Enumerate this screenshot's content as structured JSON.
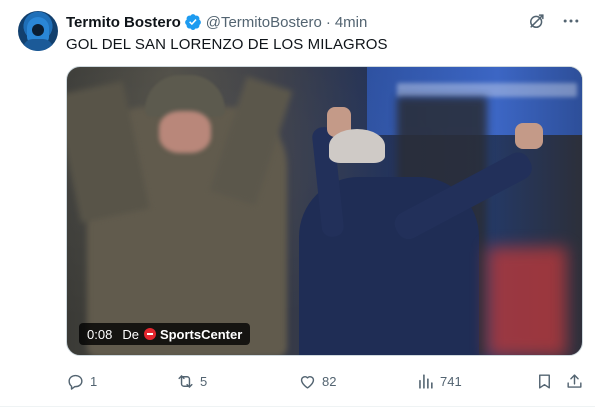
{
  "tweet": {
    "display_name": "Termito Bostero",
    "handle": "@TermitoBostero",
    "separator": "·",
    "time": "4min",
    "text": "GOL DEL SAN LORENZO DE LOS MILAGROS",
    "verified": true,
    "accent_color": "#1d9bf0"
  },
  "media": {
    "duration": "0:08",
    "from_label": "De",
    "source_name": "SportsCenter",
    "source_logo_color": "#e3262e"
  },
  "actions": {
    "replies": "1",
    "reposts": "5",
    "likes": "82",
    "views": "741"
  },
  "icons": {
    "grok": "grok-icon",
    "more": "more-icon",
    "reply": "reply-icon",
    "repost": "repost-icon",
    "like": "heart-icon",
    "views": "views-icon",
    "bookmark": "bookmark-icon",
    "share": "share-icon"
  }
}
